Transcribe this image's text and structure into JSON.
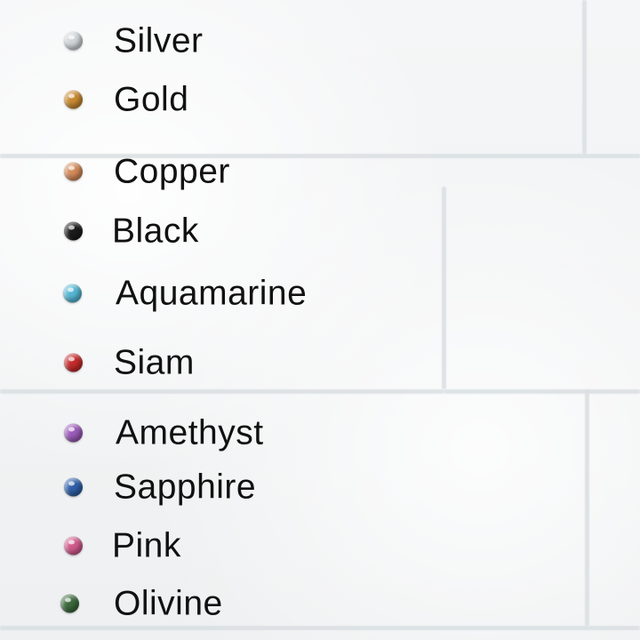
{
  "colors": [
    {
      "label": "Silver",
      "gem_color": "#cfd4d8",
      "icon": "silver-gem-icon"
    },
    {
      "label": "Gold",
      "gem_color": "#c8892f",
      "icon": "gold-gem-icon"
    },
    {
      "label": "Copper",
      "gem_color": "#d28a5a",
      "icon": "copper-gem-icon"
    },
    {
      "label": "Black",
      "gem_color": "#1b1b1b",
      "icon": "black-gem-icon"
    },
    {
      "label": "Aquamarine",
      "gem_color": "#55b6d3",
      "icon": "aquamarine-gem-icon"
    },
    {
      "label": "Siam",
      "gem_color": "#c42b2b",
      "icon": "siam-gem-icon"
    },
    {
      "label": "Amethyst",
      "gem_color": "#9b5bb8",
      "icon": "amethyst-gem-icon"
    },
    {
      "label": "Sapphire",
      "gem_color": "#2f5fa8",
      "icon": "sapphire-gem-icon"
    },
    {
      "label": "Pink",
      "gem_color": "#d05a8b",
      "icon": "pink-gem-icon"
    },
    {
      "label": "Olivine",
      "gem_color": "#3c6a3d",
      "icon": "olivine-gem-icon"
    }
  ]
}
